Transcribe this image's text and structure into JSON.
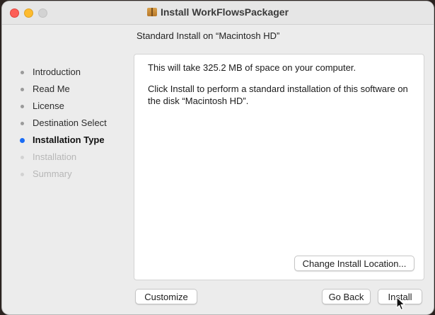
{
  "window": {
    "title": "Install WorkFlowsPackager",
    "title_icon": "package-icon"
  },
  "traffic_lights": {
    "close_color": "#fd5f57",
    "minimize_color": "#fdbb2e",
    "zoom_color": "#d3d3d3"
  },
  "subtitle": "Standard Install on “Macintosh HD”",
  "sidebar": {
    "steps": [
      {
        "label": "Introduction",
        "state": "done"
      },
      {
        "label": "Read Me",
        "state": "done"
      },
      {
        "label": "License",
        "state": "done"
      },
      {
        "label": "Destination Select",
        "state": "done"
      },
      {
        "label": "Installation Type",
        "state": "current"
      },
      {
        "label": "Installation",
        "state": "future"
      },
      {
        "label": "Summary",
        "state": "future"
      }
    ],
    "current_color": "#1a6cf5"
  },
  "content": {
    "space_text": "This will take 325.2 MB of space on your computer.",
    "instruction_text": "Click Install to perform a standard installation of this software on the disk “Macintosh HD”.",
    "change_location_label": "Change Install Location..."
  },
  "footer": {
    "customize_label": "Customize",
    "go_back_label": "Go Back",
    "install_label": "Install"
  }
}
